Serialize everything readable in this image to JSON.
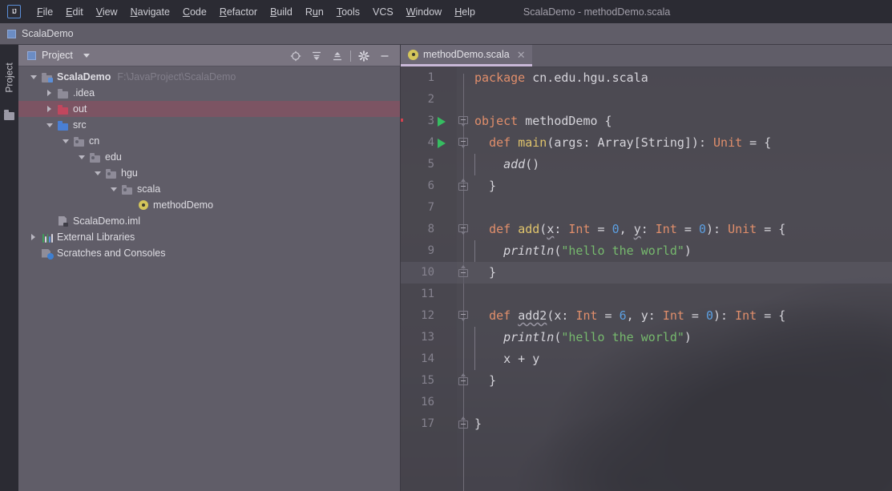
{
  "window": {
    "title": "ScalaDemo - methodDemo.scala",
    "logo_text": "IJ"
  },
  "menubar": {
    "items": [
      {
        "label": "File",
        "mnemonic": "F"
      },
      {
        "label": "Edit",
        "mnemonic": "E"
      },
      {
        "label": "View",
        "mnemonic": "V"
      },
      {
        "label": "Navigate",
        "mnemonic": "N"
      },
      {
        "label": "Code",
        "mnemonic": "C"
      },
      {
        "label": "Refactor",
        "mnemonic": "R"
      },
      {
        "label": "Build",
        "mnemonic": "B"
      },
      {
        "label": "Run",
        "mnemonic": "u"
      },
      {
        "label": "Tools",
        "mnemonic": "T"
      },
      {
        "label": "VCS",
        "mnemonic": ""
      },
      {
        "label": "Window",
        "mnemonic": "W"
      },
      {
        "label": "Help",
        "mnemonic": "H"
      }
    ]
  },
  "navbar": {
    "project_name": "ScalaDemo",
    "icon": "module-icon"
  },
  "toolstrip": {
    "project_label": "Project",
    "folder_icon": "folder-icon"
  },
  "project_panel": {
    "header": {
      "title": "Project",
      "icon": "project-icon",
      "dropdown_icon": "chevron-down-icon",
      "toolbar": [
        {
          "name": "locate-icon",
          "title": "Select Opened File"
        },
        {
          "name": "expand-all-icon",
          "title": "Expand All"
        },
        {
          "name": "collapse-all-icon",
          "title": "Collapse All"
        },
        {
          "name": "gear-icon",
          "title": "Settings"
        },
        {
          "name": "hide-icon",
          "title": "Hide"
        }
      ]
    },
    "tree": [
      {
        "label": "ScalaDemo",
        "path": "F:\\JavaProject\\ScalaDemo",
        "indent": 0,
        "arrow": "down",
        "icon": "folder-module",
        "bold": true,
        "state": "normal"
      },
      {
        "label": ".idea",
        "path": "",
        "indent": 1,
        "arrow": "right",
        "icon": "folder-plain",
        "bold": false,
        "state": "normal"
      },
      {
        "label": "out",
        "path": "",
        "indent": 1,
        "arrow": "right",
        "icon": "folder-out",
        "bold": false,
        "state": "excluded"
      },
      {
        "label": "src",
        "path": "",
        "indent": 1,
        "arrow": "down",
        "icon": "folder-source",
        "bold": false,
        "state": "normal"
      },
      {
        "label": "cn",
        "path": "",
        "indent": 2,
        "arrow": "down",
        "icon": "folder-package",
        "bold": false,
        "state": "normal"
      },
      {
        "label": "edu",
        "path": "",
        "indent": 3,
        "arrow": "down",
        "icon": "folder-package",
        "bold": false,
        "state": "normal"
      },
      {
        "label": "hgu",
        "path": "",
        "indent": 4,
        "arrow": "down",
        "icon": "folder-package",
        "bold": false,
        "state": "normal"
      },
      {
        "label": "scala",
        "path": "",
        "indent": 5,
        "arrow": "down",
        "icon": "folder-package",
        "bold": false,
        "state": "normal"
      },
      {
        "label": "methodDemo",
        "path": "",
        "indent": 6,
        "arrow": "none",
        "icon": "scala-object",
        "bold": false,
        "state": "normal"
      },
      {
        "label": "ScalaDemo.iml",
        "path": "",
        "indent": 1,
        "arrow": "none",
        "icon": "iml-file",
        "bold": false,
        "state": "normal"
      },
      {
        "label": "External Libraries",
        "path": "",
        "indent": 0,
        "arrow": "right",
        "icon": "libraries",
        "bold": false,
        "state": "normal"
      },
      {
        "label": "Scratches and Consoles",
        "path": "",
        "indent": 0,
        "arrow": "none",
        "icon": "scratches",
        "bold": false,
        "state": "normal"
      }
    ]
  },
  "editor": {
    "tab": {
      "label": "methodDemo.scala",
      "icon": "scala-object-icon",
      "close_icon": "close-icon",
      "active": true
    },
    "current_line": 10,
    "lines": [
      {
        "n": 1,
        "run": false,
        "fold": "",
        "indent_guide": false,
        "tokens": [
          {
            "t": "package",
            "c": "k"
          },
          {
            "t": " ",
            "c": "pl"
          },
          {
            "t": "cn.edu.hgu.scala",
            "c": "id"
          }
        ]
      },
      {
        "n": 2,
        "run": false,
        "fold": "",
        "indent_guide": false,
        "tokens": []
      },
      {
        "n": 3,
        "run": true,
        "fold": "open",
        "indent_guide": false,
        "tokens": [
          {
            "t": "object",
            "c": "k"
          },
          {
            "t": " ",
            "c": "pl"
          },
          {
            "t": "methodDemo",
            "c": "id"
          },
          {
            "t": " {",
            "c": "pl"
          }
        ]
      },
      {
        "n": 4,
        "run": true,
        "fold": "open",
        "indent_guide": false,
        "tokens": [
          {
            "t": "  ",
            "c": "pl"
          },
          {
            "t": "def",
            "c": "k"
          },
          {
            "t": " ",
            "c": "pl"
          },
          {
            "t": "main",
            "c": "fn"
          },
          {
            "t": "(args: ",
            "c": "pl"
          },
          {
            "t": "Array",
            "c": "id"
          },
          {
            "t": "[",
            "c": "pl"
          },
          {
            "t": "String",
            "c": "id"
          },
          {
            "t": "]): ",
            "c": "pl"
          },
          {
            "t": "Unit",
            "c": "ty"
          },
          {
            "t": " = {",
            "c": "pl"
          }
        ]
      },
      {
        "n": 5,
        "run": false,
        "fold": "",
        "indent_guide": true,
        "tokens": [
          {
            "t": "    ",
            "c": "pl"
          },
          {
            "t": "add",
            "c": "it"
          },
          {
            "t": "()",
            "c": "pl"
          }
        ]
      },
      {
        "n": 6,
        "run": false,
        "fold": "close",
        "indent_guide": false,
        "tokens": [
          {
            "t": "  }",
            "c": "pl"
          }
        ]
      },
      {
        "n": 7,
        "run": false,
        "fold": "",
        "indent_guide": false,
        "tokens": []
      },
      {
        "n": 8,
        "run": false,
        "fold": "open",
        "indent_guide": false,
        "tokens": [
          {
            "t": "  ",
            "c": "pl"
          },
          {
            "t": "def",
            "c": "k"
          },
          {
            "t": " ",
            "c": "pl"
          },
          {
            "t": "add",
            "c": "fn"
          },
          {
            "t": "(",
            "c": "pl"
          },
          {
            "t": "x",
            "c": "pl wavy"
          },
          {
            "t": ": ",
            "c": "pl"
          },
          {
            "t": "Int",
            "c": "ty"
          },
          {
            "t": " = ",
            "c": "pl"
          },
          {
            "t": "0",
            "c": "num"
          },
          {
            "t": ", ",
            "c": "pl"
          },
          {
            "t": "y",
            "c": "pl wavy"
          },
          {
            "t": ": ",
            "c": "pl"
          },
          {
            "t": "Int",
            "c": "ty"
          },
          {
            "t": " = ",
            "c": "pl"
          },
          {
            "t": "0",
            "c": "num"
          },
          {
            "t": "): ",
            "c": "pl"
          },
          {
            "t": "Unit",
            "c": "ty"
          },
          {
            "t": " = {",
            "c": "pl"
          }
        ]
      },
      {
        "n": 9,
        "run": false,
        "fold": "",
        "indent_guide": true,
        "tokens": [
          {
            "t": "    ",
            "c": "pl"
          },
          {
            "t": "println",
            "c": "it"
          },
          {
            "t": "(",
            "c": "pl"
          },
          {
            "t": "\"hello the world\"",
            "c": "str"
          },
          {
            "t": ")",
            "c": "pl"
          }
        ]
      },
      {
        "n": 10,
        "run": false,
        "fold": "close",
        "indent_guide": false,
        "tokens": [
          {
            "t": "  }",
            "c": "pl"
          }
        ]
      },
      {
        "n": 11,
        "run": false,
        "fold": "",
        "indent_guide": false,
        "tokens": []
      },
      {
        "n": 12,
        "run": false,
        "fold": "open",
        "indent_guide": false,
        "tokens": [
          {
            "t": "  ",
            "c": "pl"
          },
          {
            "t": "def",
            "c": "k"
          },
          {
            "t": " ",
            "c": "pl"
          },
          {
            "t": "add2",
            "c": "pl wavy"
          },
          {
            "t": "(x: ",
            "c": "pl"
          },
          {
            "t": "Int",
            "c": "ty"
          },
          {
            "t": " = ",
            "c": "pl"
          },
          {
            "t": "6",
            "c": "num"
          },
          {
            "t": ", y: ",
            "c": "pl"
          },
          {
            "t": "Int",
            "c": "ty"
          },
          {
            "t": " = ",
            "c": "pl"
          },
          {
            "t": "0",
            "c": "num"
          },
          {
            "t": "): ",
            "c": "pl"
          },
          {
            "t": "Int",
            "c": "ty"
          },
          {
            "t": " = {",
            "c": "pl"
          }
        ]
      },
      {
        "n": 13,
        "run": false,
        "fold": "",
        "indent_guide": true,
        "tokens": [
          {
            "t": "    ",
            "c": "pl"
          },
          {
            "t": "println",
            "c": "it"
          },
          {
            "t": "(",
            "c": "pl"
          },
          {
            "t": "\"hello the world\"",
            "c": "str"
          },
          {
            "t": ")",
            "c": "pl"
          }
        ]
      },
      {
        "n": 14,
        "run": false,
        "fold": "",
        "indent_guide": true,
        "tokens": [
          {
            "t": "    x + y",
            "c": "pl"
          }
        ]
      },
      {
        "n": 15,
        "run": false,
        "fold": "close",
        "indent_guide": false,
        "tokens": [
          {
            "t": "  }",
            "c": "pl"
          }
        ]
      },
      {
        "n": 16,
        "run": false,
        "fold": "",
        "indent_guide": false,
        "tokens": []
      },
      {
        "n": 17,
        "run": false,
        "fold": "close",
        "indent_guide": false,
        "tokens": [
          {
            "t": "}",
            "c": "pl"
          }
        ]
      }
    ]
  },
  "colors": {
    "accent_blue": "#5b8fd9",
    "keyword_orange": "#e08e6b",
    "string_green": "#76b96d",
    "number_blue": "#5c9fe0",
    "function_yellow": "#e0c46c",
    "run_green": "#36bd61",
    "excluded_red": "#c1475e",
    "tab_underline": "#c9b8d8",
    "panel_bg": "#605d68",
    "menubar_bg": "#2b2b33"
  }
}
